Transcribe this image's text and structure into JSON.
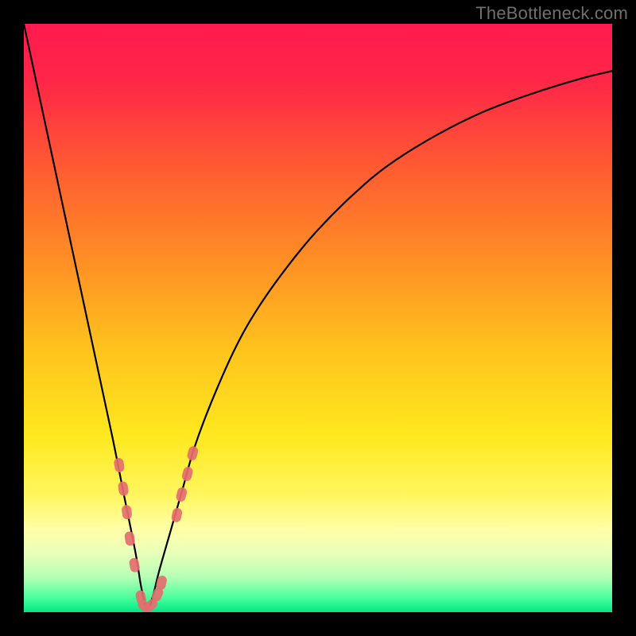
{
  "attribution": "TheBottleneck.com",
  "colors": {
    "frame": "#000000",
    "curve": "#000000",
    "markers": "#e56e6e",
    "gradient_stops": [
      {
        "offset": 0.0,
        "color": "#ff1a4f"
      },
      {
        "offset": 0.1,
        "color": "#ff2747"
      },
      {
        "offset": 0.25,
        "color": "#ff5d31"
      },
      {
        "offset": 0.4,
        "color": "#ff8e25"
      },
      {
        "offset": 0.55,
        "color": "#ffc21d"
      },
      {
        "offset": 0.7,
        "color": "#ffe81f"
      },
      {
        "offset": 0.8,
        "color": "#fff65e"
      },
      {
        "offset": 0.86,
        "color": "#ffffa8"
      },
      {
        "offset": 0.9,
        "color": "#e8ffba"
      },
      {
        "offset": 0.94,
        "color": "#b6ffb6"
      },
      {
        "offset": 0.975,
        "color": "#4bff9e"
      },
      {
        "offset": 1.0,
        "color": "#00e884"
      }
    ]
  },
  "chart_data": {
    "type": "line",
    "title": "",
    "xlabel": "",
    "ylabel": "",
    "xlim": [
      0,
      100
    ],
    "ylim": [
      0,
      100
    ],
    "note": "x and y are percentages of the plot area (x left→right, y bottom→top). Curve is a V-shape bottoming near x≈21.",
    "series": [
      {
        "name": "bottleneck-curve",
        "x": [
          0,
          3,
          6,
          9,
          12,
          15,
          17,
          19,
          20,
          21,
          22,
          23,
          25,
          27,
          29,
          32,
          36,
          40,
          45,
          50,
          56,
          62,
          70,
          78,
          86,
          94,
          100
        ],
        "y": [
          100,
          86,
          72,
          58,
          44,
          30,
          20,
          10,
          4,
          0.5,
          3,
          7,
          14,
          21,
          28,
          36,
          45,
          52,
          59,
          65,
          71,
          76,
          81,
          85,
          88,
          90.5,
          92
        ]
      }
    ],
    "markers": {
      "name": "highlight-points",
      "style": "rounded-capsule",
      "color": "#e56e6e",
      "x": [
        16.2,
        16.9,
        17.5,
        18.0,
        18.8,
        19.9,
        20.5,
        21.6,
        22.7,
        23.4,
        26.0,
        26.8,
        27.8,
        28.7
      ],
      "y": [
        25.0,
        21.0,
        17.0,
        12.5,
        8.0,
        2.5,
        1.0,
        1.2,
        3.0,
        5.0,
        16.5,
        20.0,
        23.5,
        27.0
      ]
    }
  }
}
